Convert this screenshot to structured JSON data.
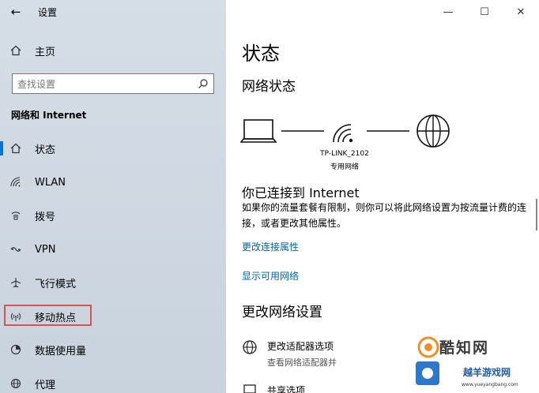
{
  "window": {
    "title": "设置"
  },
  "sidebar": {
    "home_label": "主页",
    "search_placeholder": "查找设置",
    "section_title": "网络和 Internet",
    "items": [
      {
        "label": "状态",
        "icon": "home-status-icon",
        "active": true
      },
      {
        "label": "WLAN",
        "icon": "wifi-icon"
      },
      {
        "label": "拨号",
        "icon": "dialup-icon"
      },
      {
        "label": "VPN",
        "icon": "vpn-icon"
      },
      {
        "label": "飞行模式",
        "icon": "airplane-icon"
      },
      {
        "label": "移动热点",
        "icon": "hotspot-icon"
      },
      {
        "label": "数据使用量",
        "icon": "data-usage-icon"
      },
      {
        "label": "代理",
        "icon": "globe-icon"
      }
    ]
  },
  "main": {
    "title": "状态",
    "network_status": "网络状态",
    "router_name": "TP-LINK_2102",
    "router_type": "专用网络",
    "connected_text": "你已连接到 Internet",
    "description": "如果你的流量套餐有限制，则你可以将此网络设置为按流量计费的连接，或者更改其他属性。",
    "link_properties": "更改连接属性",
    "link_available": "显示可用网络",
    "change_settings": "更改网络设置",
    "option1_title": "更改适配器选项",
    "option1_sub": "查看网络适配器并",
    "option2_title": "共享选项"
  },
  "watermark": {
    "text1": "酷知网",
    "text2": "越羊游戏网",
    "url": "www.yueyangbang.com"
  },
  "colors": {
    "accent": "#0078d7",
    "link": "#0063b1",
    "highlight": "#d9534f"
  }
}
